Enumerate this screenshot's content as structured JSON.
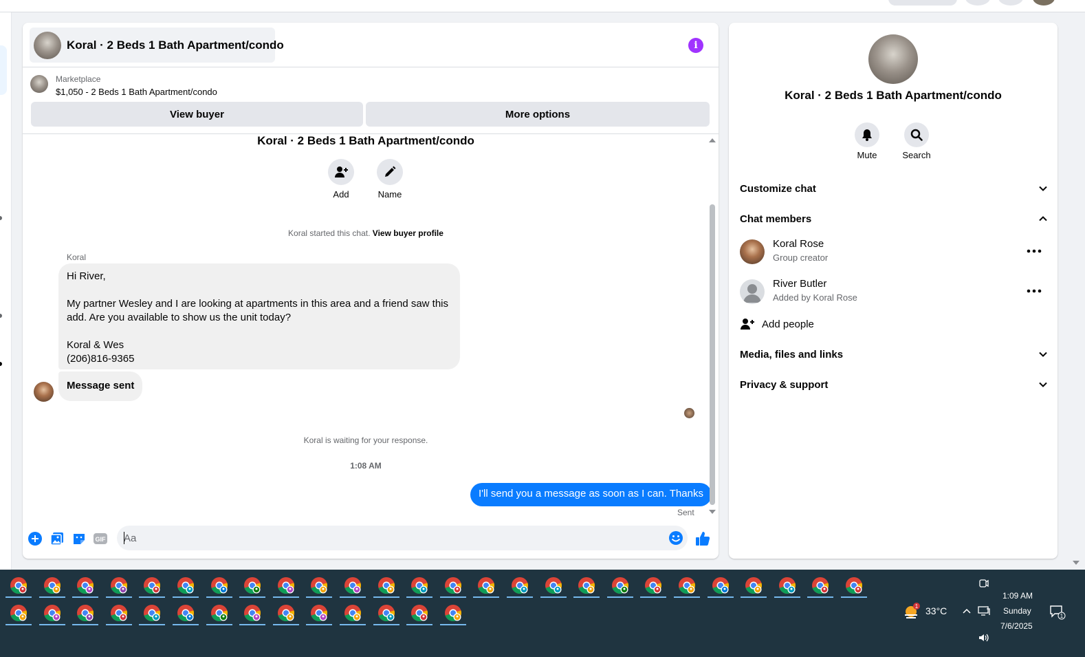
{
  "chat": {
    "title": "Koral · 2 Beds 1 Bath Apartment/condo",
    "info_icon_glyph": "i",
    "marketplace_label": "Marketplace",
    "listing_text": "$1,050 - 2 Beds 1 Bath Apartment/condo",
    "view_buyer_label": "View buyer",
    "more_options_label": "More options",
    "conversation_title": "Koral · 2 Beds 1 Bath Apartment/condo",
    "add_label": "Add",
    "name_label": "Name",
    "started_text": "Koral started this chat.",
    "view_buyer_profile": "View buyer profile",
    "sender_name": "Koral",
    "message_main": "Hi River,\n\nMy partner Wesley and I are looking at apartments in this area and a friend saw this add. Are you available to show us the unit today?\n\nKoral & Wes\n(206)816-9365",
    "message_sent": "Message sent",
    "waiting_text": "Koral is waiting for your response.",
    "timestamp": "1:08 AM",
    "outgoing_message": "I'll send you a message as soon as I can. Thanks",
    "sent_status": "Sent",
    "composer_placeholder": "Aa",
    "gif_label": "GIF"
  },
  "info_panel": {
    "title": "Koral · 2 Beds 1 Bath Apartment/condo",
    "mute_label": "Mute",
    "search_label": "Search",
    "customize_chat": "Customize chat",
    "chat_members": "Chat members",
    "members": [
      {
        "name": "Koral Rose",
        "role": "Group creator"
      },
      {
        "name": "River Butler",
        "role": "Added by Koral Rose"
      }
    ],
    "add_people": "Add people",
    "media_files_links": "Media, files and links",
    "privacy_support": "Privacy & support"
  },
  "taskbar": {
    "temperature": "33°C",
    "notification_badge": "1",
    "time": "1:09 AM",
    "day": "Sunday",
    "date": "7/6/2025",
    "action_center_count": "1"
  },
  "colors": {
    "accent_blue": "#0a7cff",
    "info_purple": "#a033ff",
    "taskbar_bg": "#1f3440"
  }
}
